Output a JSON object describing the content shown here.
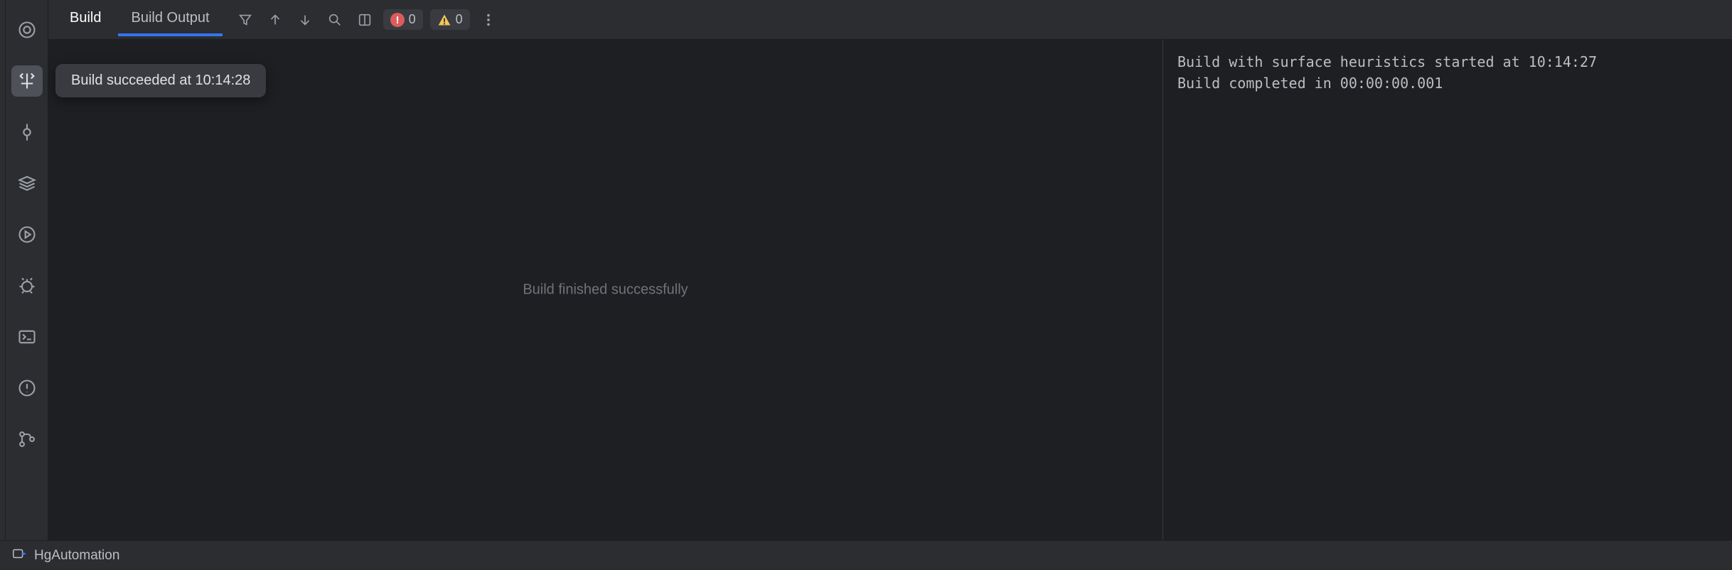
{
  "tabs": {
    "build": "Build",
    "build_output": "Build Output"
  },
  "counters": {
    "errors": "0",
    "warnings": "0"
  },
  "tooltip": "Build succeeded at 10:14:28",
  "center_message": "Build finished successfully",
  "console": {
    "line1": "Build with surface heuristics started at 10:14:27",
    "line2": "Build completed in 00:00:00.001"
  },
  "status": {
    "branch": "HgAutomation"
  }
}
